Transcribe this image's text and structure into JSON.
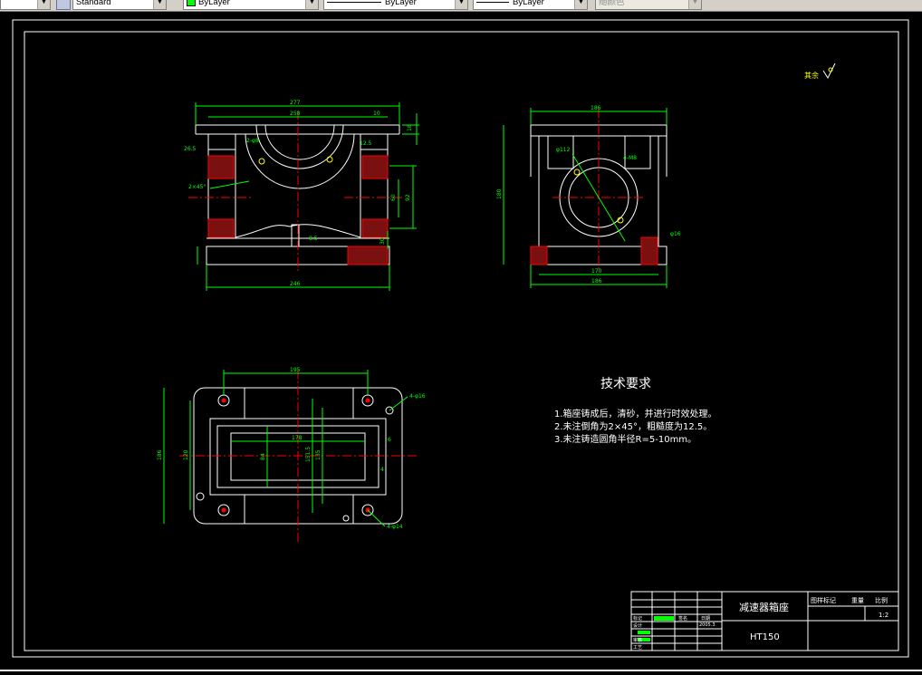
{
  "toolbar": {
    "left_arrow": "▼",
    "textstyle_value": "Standard",
    "layer_color_value": "ByLayer",
    "linetype_value": "ByLayer",
    "lineweight_value": "ByLayer",
    "plotstyle_value": "随颜色",
    "colors": {
      "layer_swatch": "#00ff00"
    }
  },
  "drawing": {
    "colors": {
      "background": "#000000",
      "outline": "#ffffff",
      "dimension": "#00ff00",
      "centerline": "#ff0000",
      "hatch": "#ff0000",
      "feature": "#ffff00"
    },
    "front_view": {
      "dims": {
        "overall": "277",
        "inner": "258",
        "top_right": "10",
        "right_flange": "18",
        "left_offset": "26.5",
        "upper_left": "2-φ8",
        "upper_right": "12.5",
        "chamfer": "2×45°",
        "height_right": "92",
        "height_left_1": "60",
        "height_left_2": "30",
        "base_width": "246",
        "middle_small": "8.5"
      }
    },
    "side_view": {
      "dims": {
        "top_width": "186",
        "height": "180",
        "bore": "φ112",
        "hole_spec": "4-M8",
        "pin": "φ16",
        "bottom_inner": "170",
        "bottom_overall": "186"
      }
    },
    "plan_view": {
      "dims": {
        "top": "195",
        "height_overall": "186",
        "height_inner": "120",
        "inner_width": "178",
        "depth_a": "84",
        "depth_b": "151.5",
        "depth_c": "135",
        "small_right_a": "6",
        "small_right_b": "4",
        "hole_top_right": "4-φ16",
        "hole_bottom_right": "4-φ14"
      }
    },
    "surface_mark": "其余"
  },
  "tech_req": {
    "title": "技术要求",
    "items": [
      "1.箱座铸成后，清砂，并进行时效处理。",
      "2.未注倒角为2×45°，粗糙度为12.5。",
      "3.未注铸造圆角半径R=5-10mm。"
    ]
  },
  "title_block": {
    "part_name": "减速器箱座",
    "material": "HT150",
    "header_labels": [
      "图样标记",
      "重量",
      "比例"
    ],
    "scale": "1:2",
    "date": "2005.3",
    "rows_left": [
      "标记",
      "设计",
      "审核",
      "工艺"
    ],
    "col_labels": [
      "签名",
      "日期"
    ]
  }
}
